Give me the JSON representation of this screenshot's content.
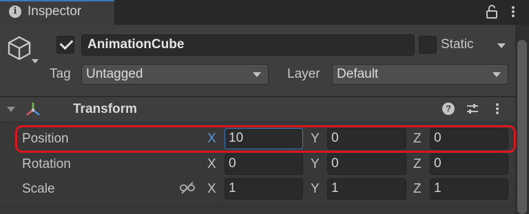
{
  "window": {
    "tab_title": "Inspector",
    "tab_icon": "info-icon"
  },
  "header_icons": {
    "lock": "lock-icon",
    "menu": "menu-dots-icon"
  },
  "gameobject": {
    "icon": "cube-icon",
    "active": true,
    "name": "AnimationCube",
    "static_label": "Static",
    "static_checked": false,
    "tag_label": "Tag",
    "tag_value": "Untagged",
    "layer_label": "Layer",
    "layer_value": "Default"
  },
  "component": {
    "title": "Transform",
    "expanded": true,
    "icon": "transform-icon",
    "actions": [
      "help-icon",
      "presets-icon",
      "menu-dots-icon"
    ],
    "properties": [
      {
        "label": "Position",
        "x": "10",
        "y": "0",
        "z": "0",
        "highlighted": true,
        "focused_axis": "X"
      },
      {
        "label": "Rotation",
        "x": "0",
        "y": "0",
        "z": "0"
      },
      {
        "label": "Scale",
        "x": "1",
        "y": "1",
        "z": "1",
        "icon": "constrain-proportions-icon"
      }
    ],
    "axes": {
      "x": "X",
      "y": "Y",
      "z": "Z"
    }
  },
  "colors": {
    "accent": "#3a79bb",
    "highlight": "#e0141e",
    "background": "#383838"
  }
}
